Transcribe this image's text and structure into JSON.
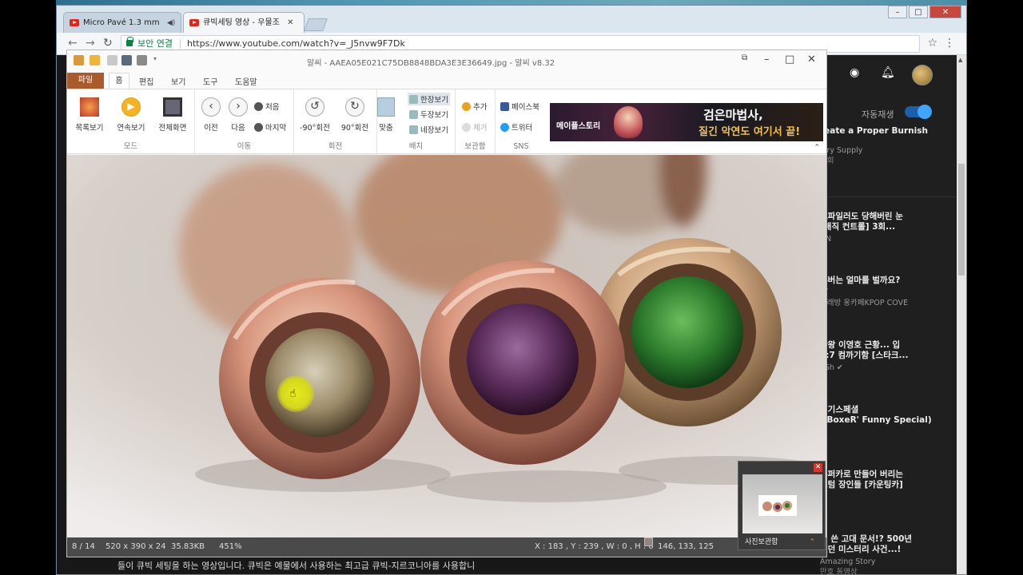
{
  "browser": {
    "tabs": [
      {
        "label": "Micro Pavé 1.3 mm",
        "active": false
      },
      {
        "label": "큐빅세팅 영상 - 우물조",
        "active": true
      }
    ],
    "secure_label": "보안 연결",
    "url": "https://www.youtube.com/watch?v=_J5nvw9F7Dk"
  },
  "viewer": {
    "title": "알씨 - AAEA05E021C75DB8848BDA3E3E36649.jpg - 알씨 v8.32",
    "menu_tabs": [
      "파일",
      "홈",
      "편집",
      "보기",
      "도구",
      "도움말"
    ],
    "groups": {
      "mode": {
        "label": "모드",
        "buttons": [
          "목록보기",
          "연속보기",
          "전체화면"
        ]
      },
      "move": {
        "label": "이동",
        "buttons": [
          "이전",
          "다음"
        ],
        "small": [
          "처음",
          "마지막"
        ]
      },
      "rotate": {
        "label": "회전",
        "buttons": [
          "-90°회전",
          "90°회전"
        ]
      },
      "arrange": {
        "label": "배치",
        "fit": "맞춤",
        "small": [
          "한장보기",
          "두장보기",
          "네장보기"
        ]
      },
      "storage": {
        "label": "보관함",
        "small": [
          "추가",
          "제거"
        ]
      },
      "sns": {
        "label": "SNS",
        "small": [
          "페이스북",
          "트위터"
        ]
      }
    },
    "ad": {
      "brand": "메이플스토리",
      "line1": "검은마법사,",
      "line2": "질긴 악연도 여기서 끝!"
    },
    "status": {
      "page": "8 / 14",
      "dims": "520 x 390 x 24",
      "size": "35.83KB",
      "zoom": "451%",
      "coords": "X : 183 , Y : 239 , W : 0 , H : 0",
      "rgb": "146, 133, 125"
    },
    "navigator_label": "사진보관함"
  },
  "youtube": {
    "autoplay_label": "자동재생",
    "items": [
      {
        "title": "reate a Proper Burnish",
        "channel": "elry Supply",
        "meta": "만회"
      },
      {
        "title": "로파일러도 당해버린 눈",
        "title2": "[매직 컨트롤] 3회...",
        "channel": "UN",
        "meta": "상"
      },
      {
        "title": "튜버는 얼마를 벌까요?",
        "title2": "황",
        "channel": "노래방 옹카페KPOP COVE",
        "meta": "상"
      },
      {
        "title": "판왕 이영호 근황... 입",
        "title2": "1:7 컴까기함 [스타크...",
        "channel": "aSh ✔",
        "meta": "상"
      },
      {
        "title": "벙기스페셜",
        "title2": "_'BoxeR' Funny Special)",
        "channel": "",
        "meta": "상"
      },
      {
        "title": "슈퍼카로 만들어 버리는",
        "title2": "스텀 장인들 [카운팅카]",
        "channel": "✔",
        "meta": "상"
      },
      {
        "title": "에 쓴 고대 문서!? 500년",
        "title2": "었던 미스터리 사건...!",
        "channel": "Amazing Story",
        "meta": "만호 동영상"
      }
    ],
    "description": "들이 큐빅 세팅을 하는 영상입니다. 큐빅은 예물에서 사용하는 최고급 큐빅-지르코니아를 사용합니"
  }
}
